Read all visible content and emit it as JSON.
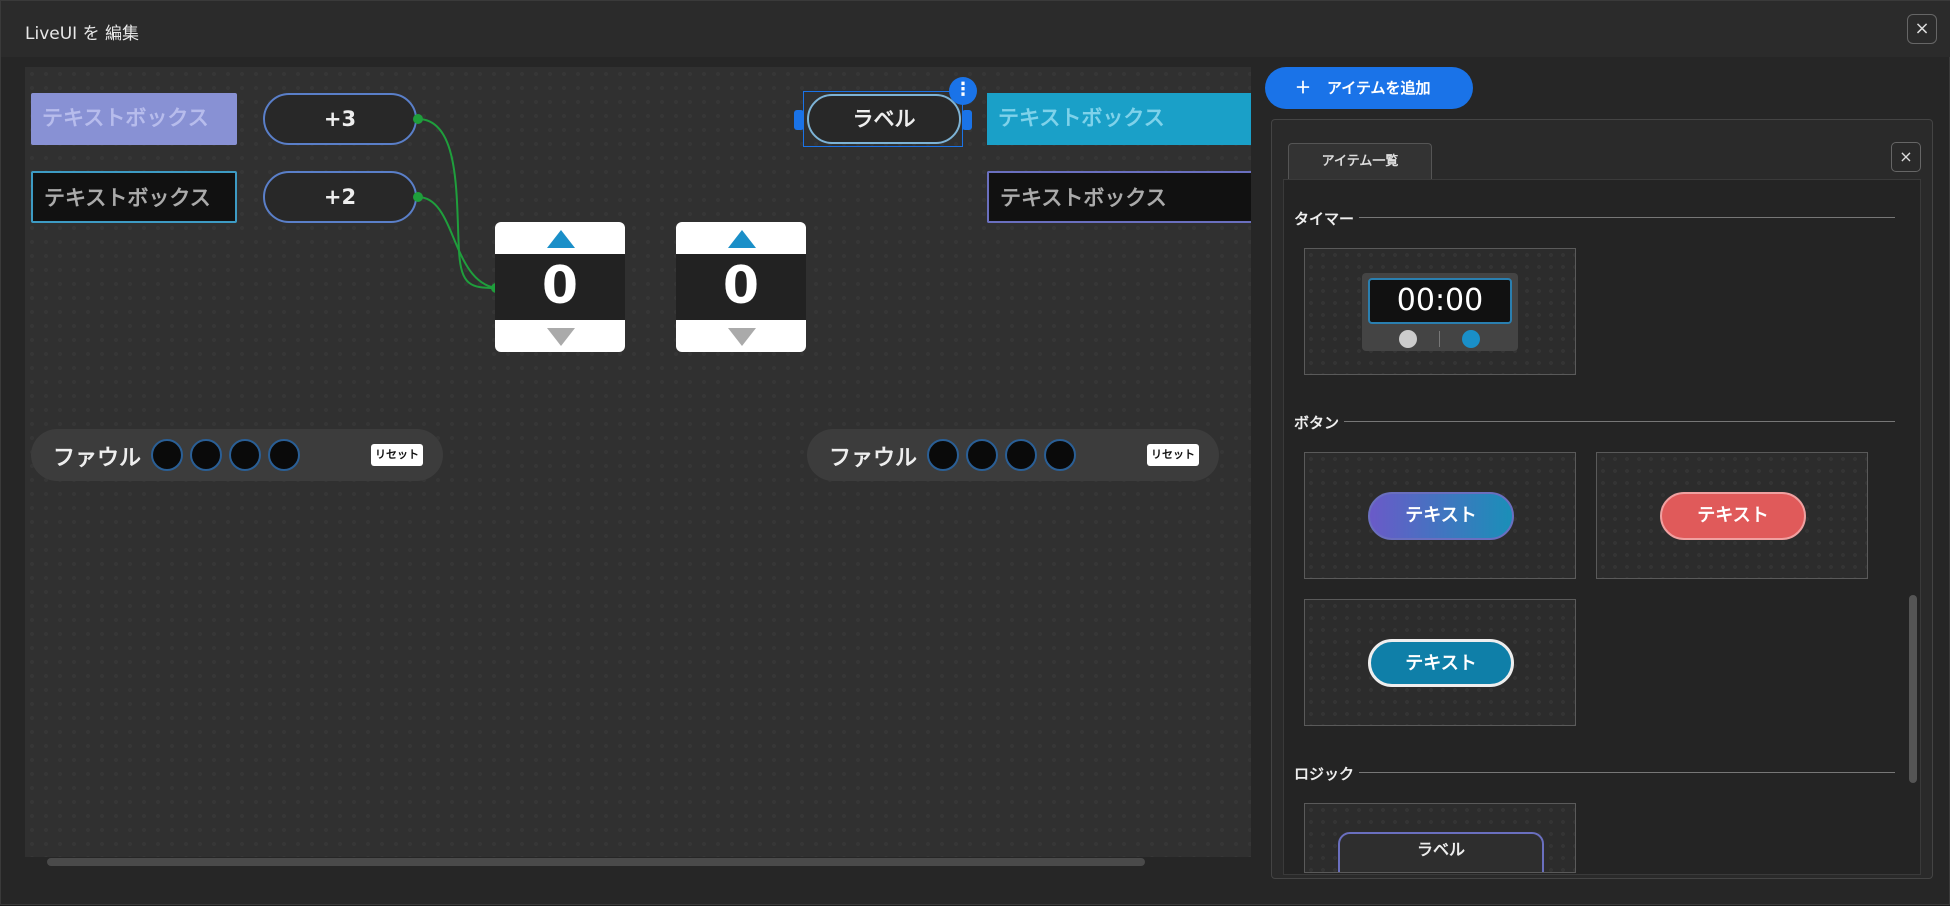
{
  "window": {
    "title": "LiveUI を 編集",
    "close_icon": "×"
  },
  "canvas": {
    "textboxes": [
      "テキストボックス",
      "テキストボックス",
      "テキストボックス",
      "テキストボックス"
    ],
    "buttons": {
      "plus3": "+3",
      "plus2": "+2"
    },
    "selected_label": {
      "text": "ラベル",
      "menu_icon": "⋮"
    },
    "counters": [
      {
        "value": "0"
      },
      {
        "value": "0"
      }
    ],
    "foul_groups": [
      {
        "label": "ファウル",
        "reset": "リセット"
      },
      {
        "label": "ファウル",
        "reset": "リセット"
      }
    ]
  },
  "add_item_button": {
    "icon": "＋",
    "label": "アイテムを追加"
  },
  "item_panel": {
    "tab": "アイテム一覧",
    "close_icon": "×",
    "sections": {
      "timer": {
        "title": "タイマー",
        "preview": "00:00"
      },
      "button": {
        "title": "ボタン",
        "previews": [
          "テキスト",
          "テキスト",
          "テキスト"
        ]
      },
      "logic": {
        "title": "ロジック",
        "preview": "ラベル"
      }
    }
  },
  "colors": {
    "accent": "#1a73e8",
    "wire": "#1f9e3c",
    "counter_up": "#1a8fc8",
    "red_button": "#e05a5a"
  }
}
